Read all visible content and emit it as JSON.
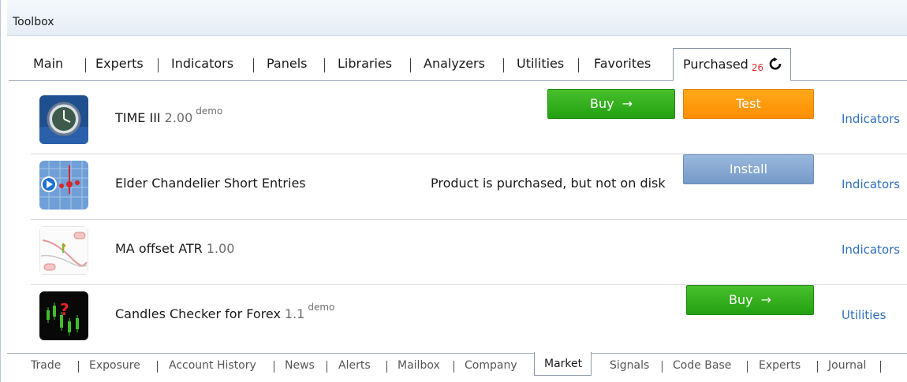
{
  "window": {
    "title": "Toolbox"
  },
  "top_tabs": [
    "Main",
    "Experts",
    "Indicators",
    "Panels",
    "Libraries",
    "Analyzers",
    "Utilities",
    "Favorites"
  ],
  "active_tab": {
    "label": "Purchased",
    "count": "26",
    "refresh_icon": "refresh-icon"
  },
  "products": [
    {
      "name": "TIME III",
      "version": "2.00",
      "demo": "demo",
      "buy": "Buy",
      "buy_arrow": "→",
      "test": "Test",
      "category": "Indicators",
      "icon": "clock-icon"
    },
    {
      "name": "Elder Chandelier Short Entries",
      "version": "",
      "status": "Product is purchased, but not on disk",
      "install": "Install",
      "category": "Indicators",
      "icon": "chart-video-icon"
    },
    {
      "name": "MA offset ATR",
      "version": "1.00",
      "category": "Indicators",
      "icon": "ma-chart-icon"
    },
    {
      "name": "Candles Checker for Forex",
      "version": "1.1",
      "demo": "demo",
      "buy": "Buy",
      "buy_arrow": "→",
      "category": "Utilities",
      "icon": "candles-icon"
    }
  ],
  "bottom_tabs": [
    "Trade",
    "Exposure",
    "Account History",
    "News",
    "Alerts",
    "Mailbox",
    "Company",
    "Market",
    "Signals",
    "Code Base",
    "Experts",
    "Journal"
  ],
  "bottom_active": "Market",
  "colors": {
    "buy": "#23a012",
    "test": "#ff8e00",
    "install": "#7599c8",
    "link": "#2f6fbf",
    "count": "#e02b2b"
  }
}
